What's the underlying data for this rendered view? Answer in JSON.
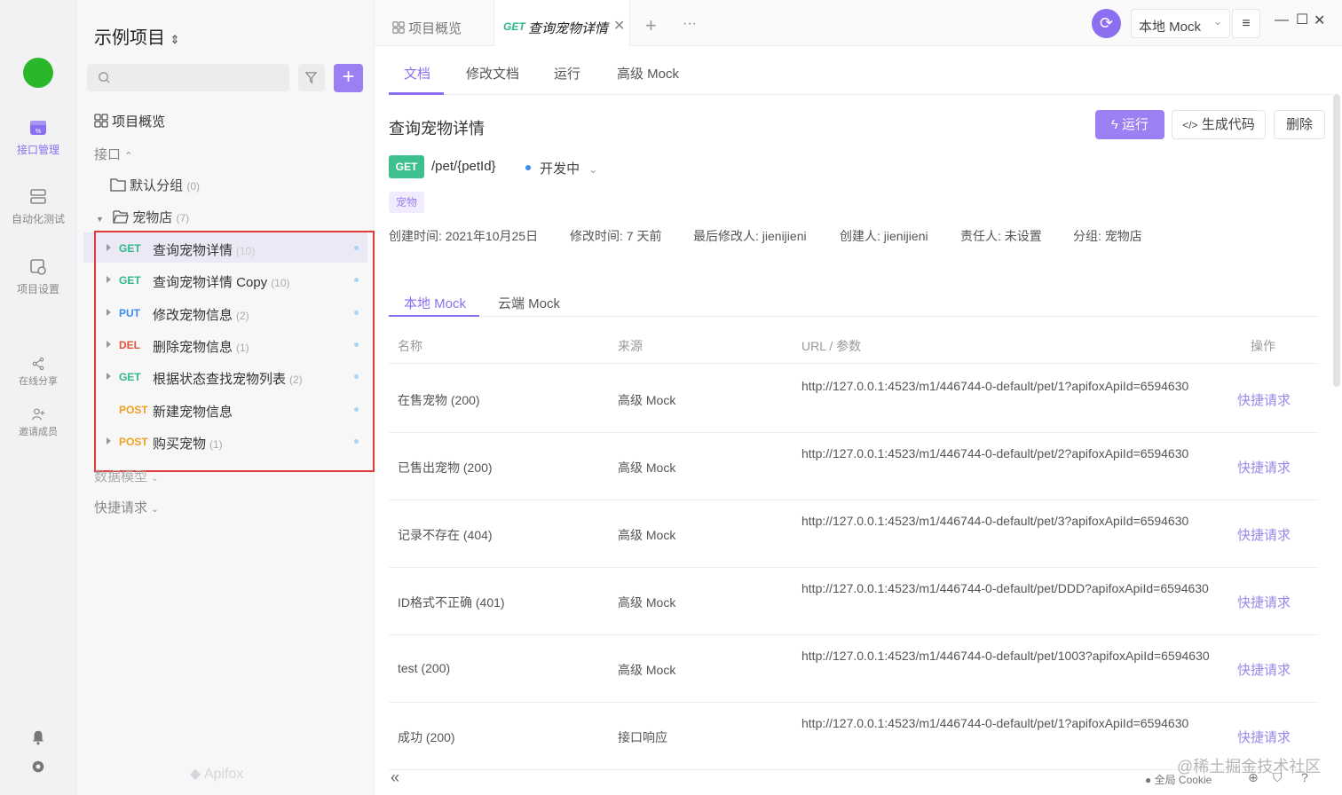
{
  "rail": {
    "items": [
      {
        "label": "接口管理",
        "icon": "api-icon"
      },
      {
        "label": "自动化测试",
        "icon": "automation-icon"
      },
      {
        "label": "项目设置",
        "icon": "settings-icon"
      },
      {
        "label": "在线分享",
        "icon": "share-icon"
      },
      {
        "label": "邀请成员",
        "icon": "invite-icon"
      }
    ],
    "avatar_color": "#2ab82a",
    "accent": "#8b6ff0"
  },
  "sidebar": {
    "project_title": "示例项目",
    "overview": "项目概览",
    "section_api": "接口",
    "default_group": "默认分组",
    "default_group_count": "(0)",
    "pet_store": "宠物店",
    "pet_store_count": "(7)",
    "apis": [
      {
        "method": "GET",
        "name": "查询宠物详情",
        "count": "(10)"
      },
      {
        "method": "GET",
        "name": "查询宠物详情 Copy",
        "count": "(10)"
      },
      {
        "method": "PUT",
        "name": "修改宠物信息",
        "count": "(2)"
      },
      {
        "method": "DEL",
        "name": "删除宠物信息",
        "count": "(1)"
      },
      {
        "method": "GET",
        "name": "根据状态查找宠物列表",
        "count": "(2)"
      },
      {
        "method": "POST",
        "name": "新建宠物信息",
        "count": ""
      },
      {
        "method": "POST",
        "name": "购买宠物",
        "count": "(1)"
      }
    ],
    "data_model": "数据模型",
    "quick_request": "快捷请求",
    "watermark": "Apifox"
  },
  "topbar": {
    "tab_overview": "项目概览",
    "tab_active_method": "GET",
    "tab_active_name": "查询宠物详情",
    "env": "本地 Mock"
  },
  "subtabs": [
    "文档",
    "修改文档",
    "运行",
    "高级 Mock"
  ],
  "api": {
    "title": "查询宠物详情",
    "method": "GET",
    "path": "/pet/{petId}",
    "status": "开发中",
    "tag": "宠物",
    "btn_run": "运行",
    "btn_code": "生成代码",
    "btn_delete": "删除",
    "meta": [
      "创建时间: 2021年10月25日",
      "修改时间: 7 天前",
      "最后修改人: jienijieni",
      "创建人: jienijieni",
      "责任人: 未设置",
      "分组: 宠物店"
    ]
  },
  "mock": {
    "tabs": [
      "本地 Mock",
      "云端 Mock"
    ],
    "headers": [
      "名称",
      "来源",
      "URL / 参数",
      "操作"
    ],
    "rows": [
      {
        "name": "在售宠物 (200)",
        "source": "高级 Mock",
        "url": "http://127.0.0.1:4523/m1/446744-0-default/pet/1?apifoxApiId=6594630",
        "action": "快捷请求"
      },
      {
        "name": "已售出宠物 (200)",
        "source": "高级 Mock",
        "url": "http://127.0.0.1:4523/m1/446744-0-default/pet/2?apifoxApiId=6594630",
        "action": "快捷请求"
      },
      {
        "name": "记录不存在 (404)",
        "source": "高级 Mock",
        "url": "http://127.0.0.1:4523/m1/446744-0-default/pet/3?apifoxApiId=6594630",
        "action": "快捷请求"
      },
      {
        "name": "ID格式不正确 (401)",
        "source": "高级 Mock",
        "url": "http://127.0.0.1:4523/m1/446744-0-default/pet/DDD?apifoxApiId=6594630",
        "action": "快捷请求"
      },
      {
        "name": "test (200)",
        "source": "高级 Mock",
        "url": "http://127.0.0.1:4523/m1/446744-0-default/pet/1003?apifoxApiId=6594630",
        "action": "快捷请求"
      },
      {
        "name": "成功 (200)",
        "source": "接口响应",
        "url": "http://127.0.0.1:4523/m1/446744-0-default/pet/1?apifoxApiId=6594630",
        "action": "快捷请求"
      }
    ]
  },
  "footer": {
    "cookie": "全局 Cookie",
    "watermark": "@稀土掘金技术社区"
  }
}
